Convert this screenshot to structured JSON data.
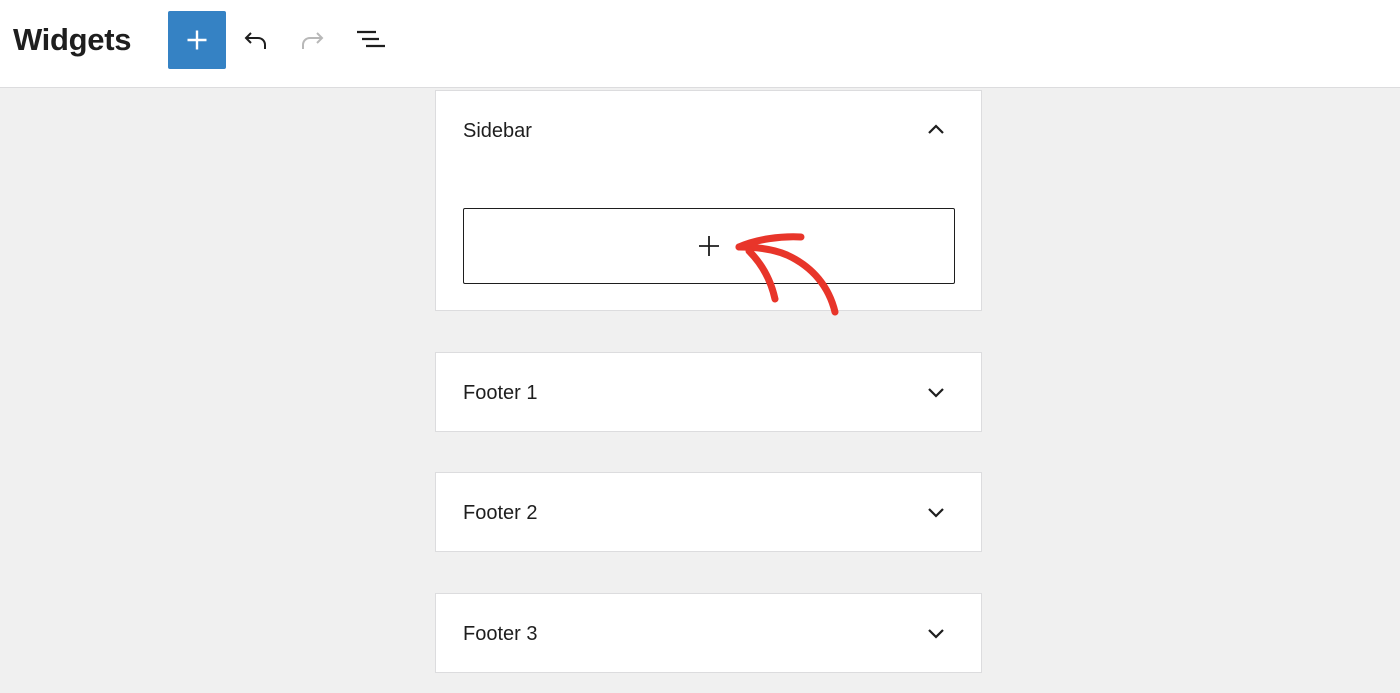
{
  "header": {
    "title": "Widgets",
    "icons": {
      "add": "plus-icon",
      "undo": "undo-icon",
      "redo": "redo-icon",
      "outline": "list-view-icon"
    },
    "accent_color": "#3582c4"
  },
  "widget_areas": [
    {
      "title": "Sidebar",
      "expanded": true,
      "chevron": "chevron-up-icon"
    },
    {
      "title": "Footer 1",
      "expanded": false,
      "chevron": "chevron-down-icon"
    },
    {
      "title": "Footer 2",
      "expanded": false,
      "chevron": "chevron-down-icon"
    },
    {
      "title": "Footer 3",
      "expanded": false,
      "chevron": "chevron-down-icon"
    }
  ],
  "annotation": {
    "icon": "red-arrow-annotation",
    "color": "#e8352a"
  }
}
